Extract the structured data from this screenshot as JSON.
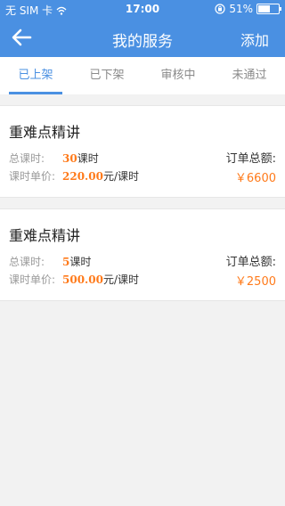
{
  "status_bar": {
    "carrier": "无 SIM 卡",
    "time": "17:00",
    "battery": "51%"
  },
  "nav": {
    "title": "我的服务",
    "add_label": "添加"
  },
  "tabs": [
    {
      "label": "已上架",
      "active": true
    },
    {
      "label": "已下架",
      "active": false
    },
    {
      "label": "审核中",
      "active": false
    },
    {
      "label": "未通过",
      "active": false
    }
  ],
  "labels": {
    "hours": "总课时:",
    "unit_price": "课时单价:",
    "order_total": "订单总额:"
  },
  "services": [
    {
      "name": "重难点精讲",
      "hours": "30",
      "hours_unit": "课时",
      "unit_price": "220.00",
      "price_unit": "元/课时",
      "total": "￥6600"
    },
    {
      "name": "重难点精讲",
      "hours": "5",
      "hours_unit": "课时",
      "unit_price": "500.00",
      "price_unit": "元/课时",
      "total": "￥2500"
    }
  ],
  "colors": {
    "primary": "#4a90e2",
    "accent": "#ff7a1a",
    "background": "#f2f2f2"
  }
}
